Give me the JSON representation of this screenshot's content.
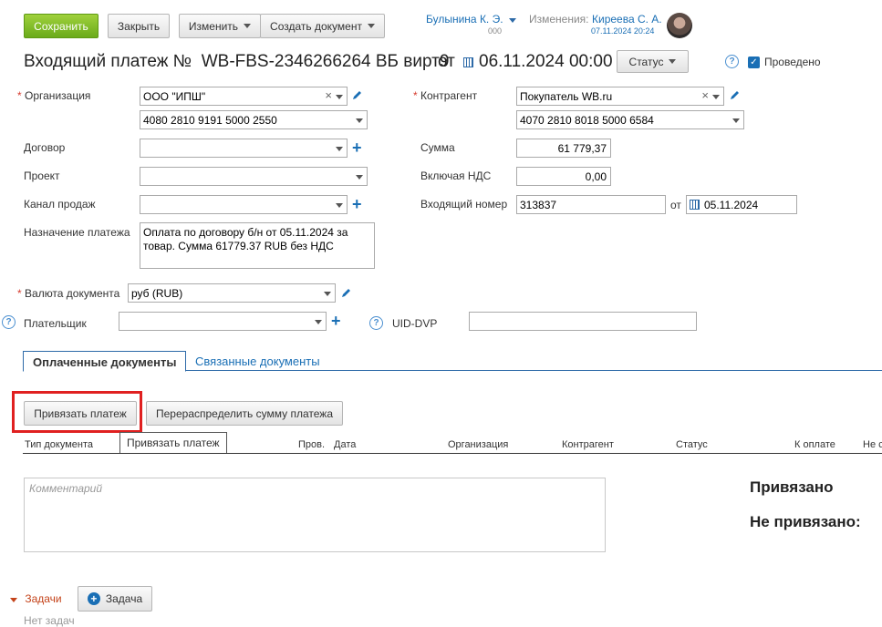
{
  "toolbar": {
    "save": "Сохранить",
    "close": "Закрыть",
    "edit": "Изменить",
    "create_doc": "Создать документ"
  },
  "header": {
    "author_name": "Булынина К. Э.",
    "author_org": "000",
    "changes_label": "Изменения:",
    "editor_name": "Киреева С. А.",
    "editor_time": "07.11.2024 20:24"
  },
  "doc": {
    "title": "Входящий платеж №",
    "number": "WB-FBS-2346266264 ВБ вирт9",
    "date_prefix": "от",
    "date": "06.11.2024 00:00",
    "status_btn": "Статус",
    "posted_label": "Проведено"
  },
  "form": {
    "org_label": "Организация",
    "org_value": "ООО \"ИПШ\"",
    "org_account": "4080 2810 9191 5000 2550",
    "contractor_label": "Контрагент",
    "contractor_value": "Покупатель WB.ru",
    "contractor_account": "4070 2810 8018 5000 6584",
    "contract_label": "Договор",
    "sum_label": "Сумма",
    "sum_value": "61 779,37",
    "project_label": "Проект",
    "vat_label": "Включая НДС",
    "vat_value": "0,00",
    "channel_label": "Канал продаж",
    "in_number_label": "Входящий номер",
    "in_number_value": "313837",
    "in_date_prefix": "от",
    "in_date_value": "05.11.2024",
    "purpose_label": "Назначение платежа",
    "purpose_line1": "Оплата по договору б/н от 05.11.2024 за",
    "purpose_line2": "товар. Сумма 61779.37 RUB без НДС",
    "currency_label": "Валюта документа",
    "currency_value": "руб (RUB)",
    "payer_label": "Плательщик",
    "uid_label": "UID-DVP"
  },
  "tabs": {
    "paid": "Оплаченные документы",
    "linked": "Связанные документы"
  },
  "actions": {
    "bind": "Привязать платеж",
    "redistribute": "Перераспределить сумму платежа",
    "tooltip": "Привязать платеж"
  },
  "table": {
    "columns": [
      "Тип документа",
      "Пров.",
      "Дата",
      "Организация",
      "Контрагент",
      "Статус",
      "К оплате",
      "Не с"
    ]
  },
  "comment_placeholder": "Комментарий",
  "summary": {
    "bound": "Привязано",
    "unbound": "Не привязано:"
  },
  "tasks": {
    "label": "Задачи",
    "add_btn": "Задача",
    "empty": "Нет задач"
  },
  "colors": {
    "accent": "#1a6fb5",
    "save_green": "#7cbb23",
    "highlight_red": "#e02020"
  }
}
